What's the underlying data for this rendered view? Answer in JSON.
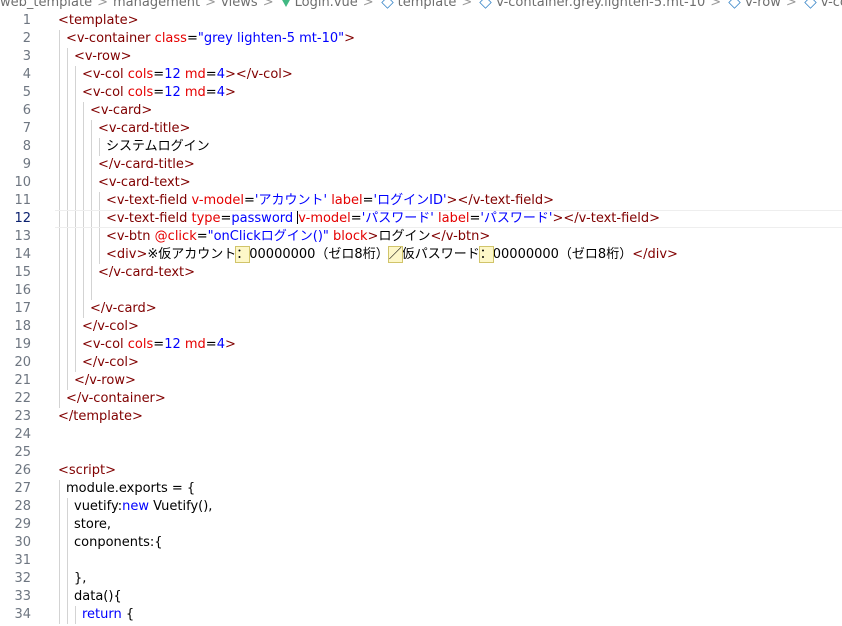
{
  "breadcrumb": {
    "items": [
      {
        "label": "web_template",
        "icon": ""
      },
      {
        "label": "management",
        "icon": ""
      },
      {
        "label": "views",
        "icon": ""
      },
      {
        "label": "Login.vue",
        "icon": "vue-icon"
      },
      {
        "label": "template",
        "icon": "cube-icon"
      },
      {
        "label": "v-container.grey.lighten-5.mt-10",
        "icon": "cube-icon"
      },
      {
        "label": "v-row",
        "icon": "cube-icon"
      },
      {
        "label": "v-col",
        "icon": "cube-icon"
      },
      {
        "label": "v-c",
        "icon": "cube-icon"
      }
    ],
    "separator": ">"
  },
  "editor": {
    "current_line": 12,
    "colors": {
      "tag": "#800000",
      "attr": "#e50000",
      "string": "#0000ff",
      "text": "#000000",
      "line_number": "#6e7681"
    },
    "lines": [
      {
        "n": "1",
        "indent": 0,
        "tokens": [
          [
            "tag",
            "<template>"
          ]
        ]
      },
      {
        "n": "2",
        "indent": 1,
        "tokens": [
          [
            "tag",
            "<v-container"
          ],
          [
            "t",
            " "
          ],
          [
            "attr",
            "class"
          ],
          [
            "t",
            "="
          ],
          [
            "str",
            "\"grey lighten-5 mt-10\""
          ],
          [
            "tag",
            ">"
          ]
        ]
      },
      {
        "n": "3",
        "indent": 2,
        "tokens": [
          [
            "tag",
            "<v-row>"
          ]
        ]
      },
      {
        "n": "4",
        "indent": 3,
        "tokens": [
          [
            "tag",
            "<v-col"
          ],
          [
            "t",
            " "
          ],
          [
            "attr",
            "cols"
          ],
          [
            "t",
            "="
          ],
          [
            "str",
            "12"
          ],
          [
            "t",
            " "
          ],
          [
            "attr",
            "md"
          ],
          [
            "t",
            "="
          ],
          [
            "str",
            "4"
          ],
          [
            "tag",
            "></v-col>"
          ]
        ]
      },
      {
        "n": "5",
        "indent": 3,
        "tokens": [
          [
            "tag",
            "<v-col"
          ],
          [
            "t",
            " "
          ],
          [
            "attr",
            "cols"
          ],
          [
            "t",
            "="
          ],
          [
            "str",
            "12"
          ],
          [
            "t",
            " "
          ],
          [
            "attr",
            "md"
          ],
          [
            "t",
            "="
          ],
          [
            "str",
            "4"
          ],
          [
            "tag",
            ">"
          ]
        ]
      },
      {
        "n": "6",
        "indent": 4,
        "tokens": [
          [
            "tag",
            "<v-card>"
          ]
        ]
      },
      {
        "n": "7",
        "indent": 5,
        "tokens": [
          [
            "tag",
            "<v-card-title>"
          ]
        ]
      },
      {
        "n": "8",
        "indent": 6,
        "tokens": [
          [
            "t",
            "システムログイン"
          ]
        ]
      },
      {
        "n": "9",
        "indent": 5,
        "tokens": [
          [
            "tag",
            "</v-card-title>"
          ]
        ]
      },
      {
        "n": "10",
        "indent": 5,
        "tokens": [
          [
            "tag",
            "<v-card-text>"
          ]
        ]
      },
      {
        "n": "11",
        "indent": 6,
        "tokens": [
          [
            "tag",
            "<v-text-field"
          ],
          [
            "t",
            " "
          ],
          [
            "attr",
            "v-model"
          ],
          [
            "t",
            "="
          ],
          [
            "str",
            "'アカウント'"
          ],
          [
            "t",
            " "
          ],
          [
            "attr",
            "label"
          ],
          [
            "t",
            "="
          ],
          [
            "str",
            "'ログインID'"
          ],
          [
            "tag",
            "></v-text-field>"
          ]
        ]
      },
      {
        "n": "12",
        "indent": 6,
        "tokens": [
          [
            "tag",
            "<v-text-field"
          ],
          [
            "t",
            " "
          ],
          [
            "attr",
            "type"
          ],
          [
            "t",
            "="
          ],
          [
            "str",
            "password"
          ],
          [
            "t",
            " "
          ],
          [
            "caret",
            ""
          ],
          [
            "attr",
            "v-model"
          ],
          [
            "t",
            "="
          ],
          [
            "str",
            "'パスワード'"
          ],
          [
            "t",
            " "
          ],
          [
            "attr",
            "label"
          ],
          [
            "t",
            "="
          ],
          [
            "str",
            "'パスワード'"
          ],
          [
            "tag",
            "></v-text-field>"
          ]
        ]
      },
      {
        "n": "13",
        "indent": 6,
        "tokens": [
          [
            "tag",
            "<v-btn"
          ],
          [
            "t",
            " "
          ],
          [
            "attr",
            "@click"
          ],
          [
            "t",
            "="
          ],
          [
            "str",
            "\"onClickログイン()\""
          ],
          [
            "t",
            " "
          ],
          [
            "attr",
            "block"
          ],
          [
            "tag",
            ">"
          ],
          [
            "t",
            "ログイン"
          ],
          [
            "tag",
            "</v-btn>"
          ]
        ]
      },
      {
        "n": "14",
        "indent": 6,
        "tokens": [
          [
            "tag",
            "<div>"
          ],
          [
            "t",
            "※仮アカウント"
          ],
          [
            "hl",
            "："
          ],
          [
            "t",
            "00000000（ゼロ8桁）"
          ],
          [
            "hl",
            "／"
          ],
          [
            "t",
            "仮パスワード"
          ],
          [
            "hl",
            "："
          ],
          [
            "t",
            "00000000（ゼロ8桁）"
          ],
          [
            "tag",
            "</div>"
          ]
        ]
      },
      {
        "n": "15",
        "indent": 5,
        "tokens": [
          [
            "tag",
            "</v-card-text>"
          ]
        ]
      },
      {
        "n": "16",
        "indent": 5,
        "tokens": []
      },
      {
        "n": "17",
        "indent": 4,
        "tokens": [
          [
            "tag",
            "</v-card>"
          ]
        ]
      },
      {
        "n": "18",
        "indent": 3,
        "tokens": [
          [
            "tag",
            "</v-col>"
          ]
        ]
      },
      {
        "n": "19",
        "indent": 3,
        "tokens": [
          [
            "tag",
            "<v-col"
          ],
          [
            "t",
            " "
          ],
          [
            "attr",
            "cols"
          ],
          [
            "t",
            "="
          ],
          [
            "str",
            "12"
          ],
          [
            "t",
            " "
          ],
          [
            "attr",
            "md"
          ],
          [
            "t",
            "="
          ],
          [
            "str",
            "4"
          ],
          [
            "tag",
            ">"
          ]
        ]
      },
      {
        "n": "20",
        "indent": 3,
        "tokens": [
          [
            "tag",
            "</v-col>"
          ]
        ]
      },
      {
        "n": "21",
        "indent": 2,
        "tokens": [
          [
            "tag",
            "</v-row>"
          ]
        ]
      },
      {
        "n": "22",
        "indent": 1,
        "tokens": [
          [
            "tag",
            "</v-container>"
          ]
        ]
      },
      {
        "n": "23",
        "indent": 0,
        "tokens": [
          [
            "tag",
            "</template>"
          ]
        ]
      },
      {
        "n": "24",
        "indent": 0,
        "tokens": []
      },
      {
        "n": "25",
        "indent": 0,
        "tokens": []
      },
      {
        "n": "26",
        "indent": 0,
        "tokens": [
          [
            "tag",
            "<script>"
          ]
        ]
      },
      {
        "n": "27",
        "indent": 1,
        "tokens": [
          [
            "t",
            "module.exports = {"
          ]
        ]
      },
      {
        "n": "28",
        "indent": 2,
        "tokens": [
          [
            "t",
            "vuetify:"
          ],
          [
            "kw",
            "new"
          ],
          [
            "t",
            " Vuetify(),"
          ]
        ]
      },
      {
        "n": "29",
        "indent": 2,
        "tokens": [
          [
            "t",
            "store,"
          ]
        ]
      },
      {
        "n": "30",
        "indent": 2,
        "tokens": [
          [
            "t",
            "conponents:{"
          ]
        ]
      },
      {
        "n": "31",
        "indent": 2,
        "tokens": []
      },
      {
        "n": "32",
        "indent": 2,
        "tokens": [
          [
            "t",
            "},"
          ]
        ]
      },
      {
        "n": "33",
        "indent": 2,
        "tokens": [
          [
            "t",
            "data(){"
          ]
        ]
      },
      {
        "n": "34",
        "indent": 3,
        "tokens": [
          [
            "kw",
            "return"
          ],
          [
            "t",
            " {"
          ]
        ]
      }
    ]
  }
}
